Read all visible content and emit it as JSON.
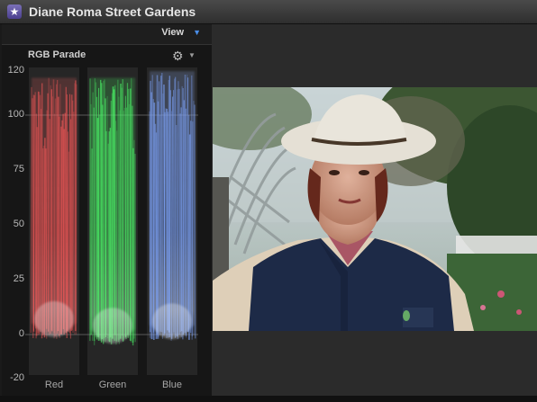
{
  "window": {
    "title": "Diane Roma Street Gardens"
  },
  "icons": {
    "app": "star-icon",
    "gear": "gear-icon",
    "dropdown": "triangle-down-icon"
  },
  "view_menu": {
    "label": "View"
  },
  "scope": {
    "name": "RGB Parade"
  },
  "colors": {
    "red": "#ff5a5a",
    "green": "#4cff6a",
    "blue": "#7fa6ff",
    "accent": "#4a8ee8"
  },
  "chart_data": {
    "type": "waveform",
    "title": "RGB Parade",
    "y_ticks": [
      120,
      100,
      75,
      50,
      25,
      0,
      -20
    ],
    "ylim": [
      -20,
      120
    ],
    "channels": [
      "Red",
      "Green",
      "Blue"
    ],
    "series": [
      {
        "name": "Red",
        "min": -2,
        "max": 117
      },
      {
        "name": "Green",
        "min": -5,
        "max": 117
      },
      {
        "name": "Blue",
        "min": -3,
        "max": 120
      }
    ]
  }
}
